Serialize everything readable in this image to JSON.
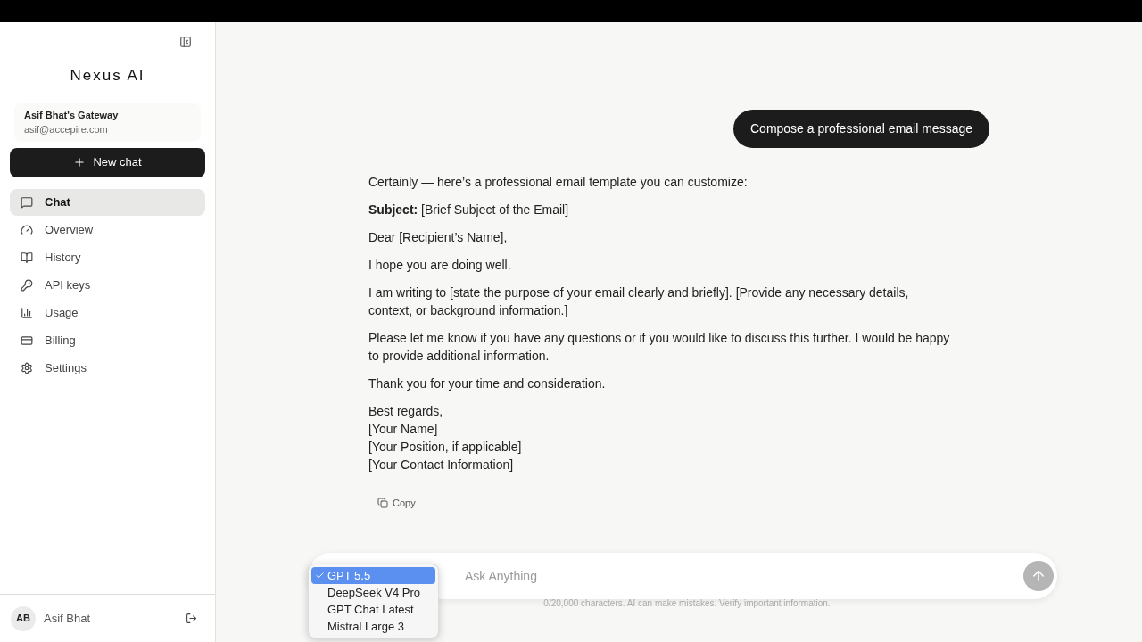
{
  "sidebar": {
    "logo": "Nexus AI",
    "account": {
      "name": "Asif Bhat's Gateway",
      "email": "asif@accepire.com"
    },
    "new_chat": "New chat",
    "items": [
      {
        "label": "Chat",
        "selected": true
      },
      {
        "label": "Overview",
        "selected": false
      },
      {
        "label": "History",
        "selected": false
      },
      {
        "label": "API keys",
        "selected": false
      },
      {
        "label": "Usage",
        "selected": false
      },
      {
        "label": "Billing",
        "selected": false
      },
      {
        "label": "Settings",
        "selected": false
      }
    ],
    "user": {
      "initials": "AB",
      "name": "Asif Bhat"
    }
  },
  "chat": {
    "user_message": "Compose a professional email message",
    "reply": [
      {
        "kind": "paragraph",
        "text": "Certainly — here’s a professional email template you can customize:"
      },
      {
        "kind": "paragraph",
        "text": "**Subject:** [Brief Subject of the Email]"
      },
      {
        "kind": "paragraph",
        "text": "Dear [Recipient’s Name],"
      },
      {
        "kind": "paragraph",
        "text": "I hope you are doing well."
      },
      {
        "kind": "paragraph",
        "text": "I am writing to [state the purpose of your email clearly and briefly]. [Provide any necessary details, context, or background information.]"
      },
      {
        "kind": "paragraph",
        "text": "Please let me know if you have any questions or if you would like to discuss this further. I would be happy to provide additional information."
      },
      {
        "kind": "paragraph",
        "text": "Thank you for your time and consideration."
      },
      {
        "kind": "lines",
        "lines": [
          "Best regards,",
          "[Your Name]",
          "[Your Position, if applicable]",
          "[Your Contact Information]"
        ]
      }
    ],
    "copy": "Copy"
  },
  "composer": {
    "placeholder": "Ask Anything",
    "models": [
      {
        "label": "GPT 5.5",
        "selected": true
      },
      {
        "label": "DeepSeek V4 Pro",
        "selected": false
      },
      {
        "label": "GPT Chat Latest",
        "selected": false
      },
      {
        "label": "Mistral Large 3",
        "selected": false
      }
    ],
    "footer": "0/20,000 characters. AI can make mistakes. Verify important information."
  }
}
